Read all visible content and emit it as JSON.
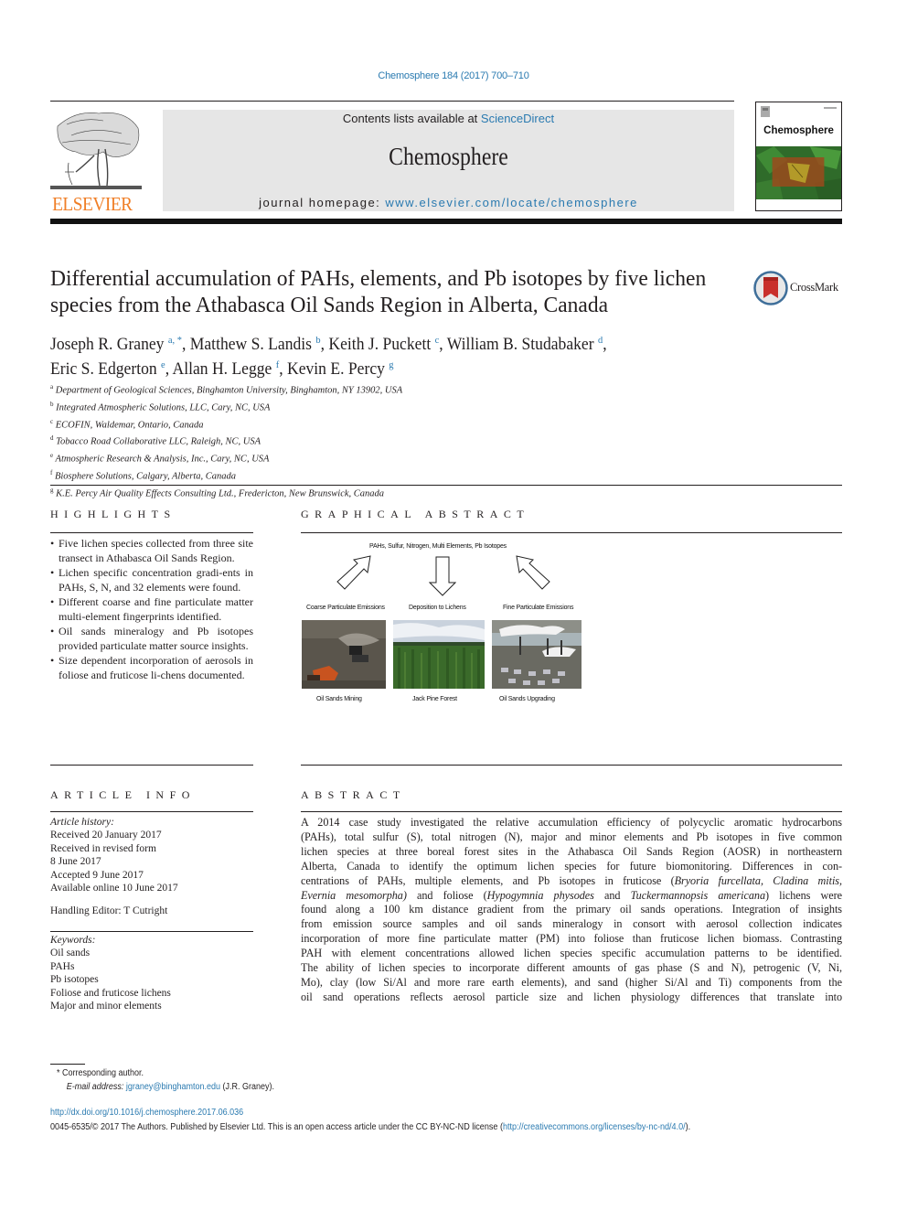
{
  "journal_ref": "Chemosphere 184 (2017) 700–710",
  "header": {
    "publisher_logo_text": "ELSEVIER",
    "contents_prefix": "Contents lists available at ",
    "contents_link": "ScienceDirect",
    "journal_name": "Chemosphere",
    "homepage_prefix": "journal homepage: ",
    "homepage_link": "www.elsevier.com/locate/chemosphere",
    "cover_title": "Chemosphere"
  },
  "crossmark_label": "CrossMark",
  "title": "Differential accumulation of PAHs, elements, and Pb isotopes by five lichen species from the Athabasca Oil Sands Region in Alberta, Canada",
  "authors": [
    {
      "name": "Joseph R. Graney",
      "sup": "a, *",
      "sep": ", "
    },
    {
      "name": "Matthew S. Landis",
      "sup": "b",
      "sep": ", "
    },
    {
      "name": "Keith J. Puckett",
      "sup": "c",
      "sep": ", "
    },
    {
      "name": "William B. Studabaker",
      "sup": "d",
      "sep": ","
    },
    {
      "name": "Eric S. Edgerton",
      "sup": "e",
      "sep": ", "
    },
    {
      "name": "Allan H. Legge",
      "sup": "f",
      "sep": ", "
    },
    {
      "name": "Kevin E. Percy",
      "sup": "g",
      "sep": ""
    }
  ],
  "affiliations": [
    {
      "key": "a",
      "text": "Department of Geological Sciences, Binghamton University, Binghamton, NY 13902, USA"
    },
    {
      "key": "b",
      "text": "Integrated Atmospheric Solutions, LLC, Cary, NC, USA"
    },
    {
      "key": "c",
      "text": "ECOFIN, Waldemar, Ontario, Canada"
    },
    {
      "key": "d",
      "text": "Tobacco Road Collaborative LLC, Raleigh, NC, USA"
    },
    {
      "key": "e",
      "text": "Atmospheric Research & Analysis, Inc., Cary, NC, USA"
    },
    {
      "key": "f",
      "text": "Biosphere Solutions, Calgary, Alberta, Canada"
    },
    {
      "key": "g",
      "text": "K.E. Percy Air Quality Effects Consulting Ltd., Fredericton, New Brunswick, Canada"
    }
  ],
  "highlights": {
    "heading": "HIGHLIGHTS",
    "items": [
      "Five lichen species collected from three site transect in Athabasca Oil Sands Region.",
      "Lichen specific concentration gradi-ents in PAHs, S, N, and 32 elements were found.",
      "Different coarse and fine particulate matter multi-element fingerprints identified.",
      "Oil sands mineralogy and Pb isotopes provided particulate matter source insights.",
      "Size dependent incorporation of aerosols in foliose and fruticose li-chens documented."
    ]
  },
  "graphical_abstract": {
    "heading": "GRAPHICAL ABSTRACT",
    "top_label": "PAHs, Sulfur, Nitrogen, Multi Elements, Pb Isotopes",
    "mid_labels": [
      "Coarse Particulate Emissions",
      "Deposition to Lichens",
      "Fine Particulate Emissions"
    ],
    "photo_labels": [
      "Oil Sands Mining",
      "Jack Pine Forest",
      "Oil Sands Upgrading"
    ]
  },
  "article_info": {
    "heading": "ARTICLE INFO",
    "history_label": "Article history:",
    "history": [
      "Received 20 January 2017",
      "Received in revised form",
      "8 June 2017",
      "Accepted 9 June 2017",
      "Available online 10 June 2017"
    ],
    "handling_editor": "Handling Editor: T Cutright",
    "keywords_label": "Keywords:",
    "keywords": [
      "Oil sands",
      "PAHs",
      "Pb isotopes",
      "Foliose and fruticose lichens",
      "Major and minor elements"
    ]
  },
  "abstract": {
    "heading": "ABSTRACT",
    "lines": [
      "A 2014 case study investigated the relative accumulation efficiency of polycyclic aromatic hydrocarbons",
      "(PAHs), total sulfur (S), total nitrogen (N), major and minor elements and Pb isotopes in five common",
      "lichen species at three boreal forest sites in the Athabasca Oil Sands Region (AOSR) in northeastern",
      "Alberta, Canada to identify the optimum lichen species for future biomonitoring. Differences in con-",
      "centrations of PAHs, multiple elements, and Pb isotopes in fruticose (<i>Bryoria furcellata, Cladina mitis,</i>",
      "<i>Evernia mesomorpha)</i> and foliose (<i>Hypogymnia physodes</i> and <i>Tuckermannopsis americana</i>) lichens were",
      "found along a 100 km distance gradient from the primary oil sands operations. Integration of insights",
      "from emission source samples and oil sands mineralogy in consort with aerosol collection indicates",
      "incorporation of more fine particulate matter (PM) into foliose than fruticose lichen biomass. Contrasting",
      "PAH with element concentrations allowed lichen species specific accumulation patterns to be identified.",
      "The ability of lichen species to incorporate different amounts of gas phase (S and N), petrogenic (V, Ni,",
      "Mo), clay (low Si/Al and more rare earth elements), and sand (higher Si/Al and Ti) components from the",
      "oil sand operations reflects aerosol particle size and lichen physiology differences that translate into"
    ]
  },
  "footnote": {
    "corresponding": "* Corresponding author.",
    "email_label": "E-mail address: ",
    "email": "jgraney@binghamton.edu",
    "email_suffix": " (J.R. Graney)."
  },
  "doi": "http://dx.doi.org/10.1016/j.chemosphere.2017.06.036",
  "license": {
    "prefix": "0045-6535/© 2017 The Authors. Published by Elsevier Ltd. This is an open access article under the CC BY-NC-ND license (",
    "link": "http://creativecommons.org/licenses/by-nc-nd/4.0/",
    "suffix": ")."
  },
  "colors": {
    "link": "#2a7ab0",
    "elsevier_orange": "#f07e26",
    "header_gray": "#e6e6e6",
    "text": "#231f20"
  }
}
